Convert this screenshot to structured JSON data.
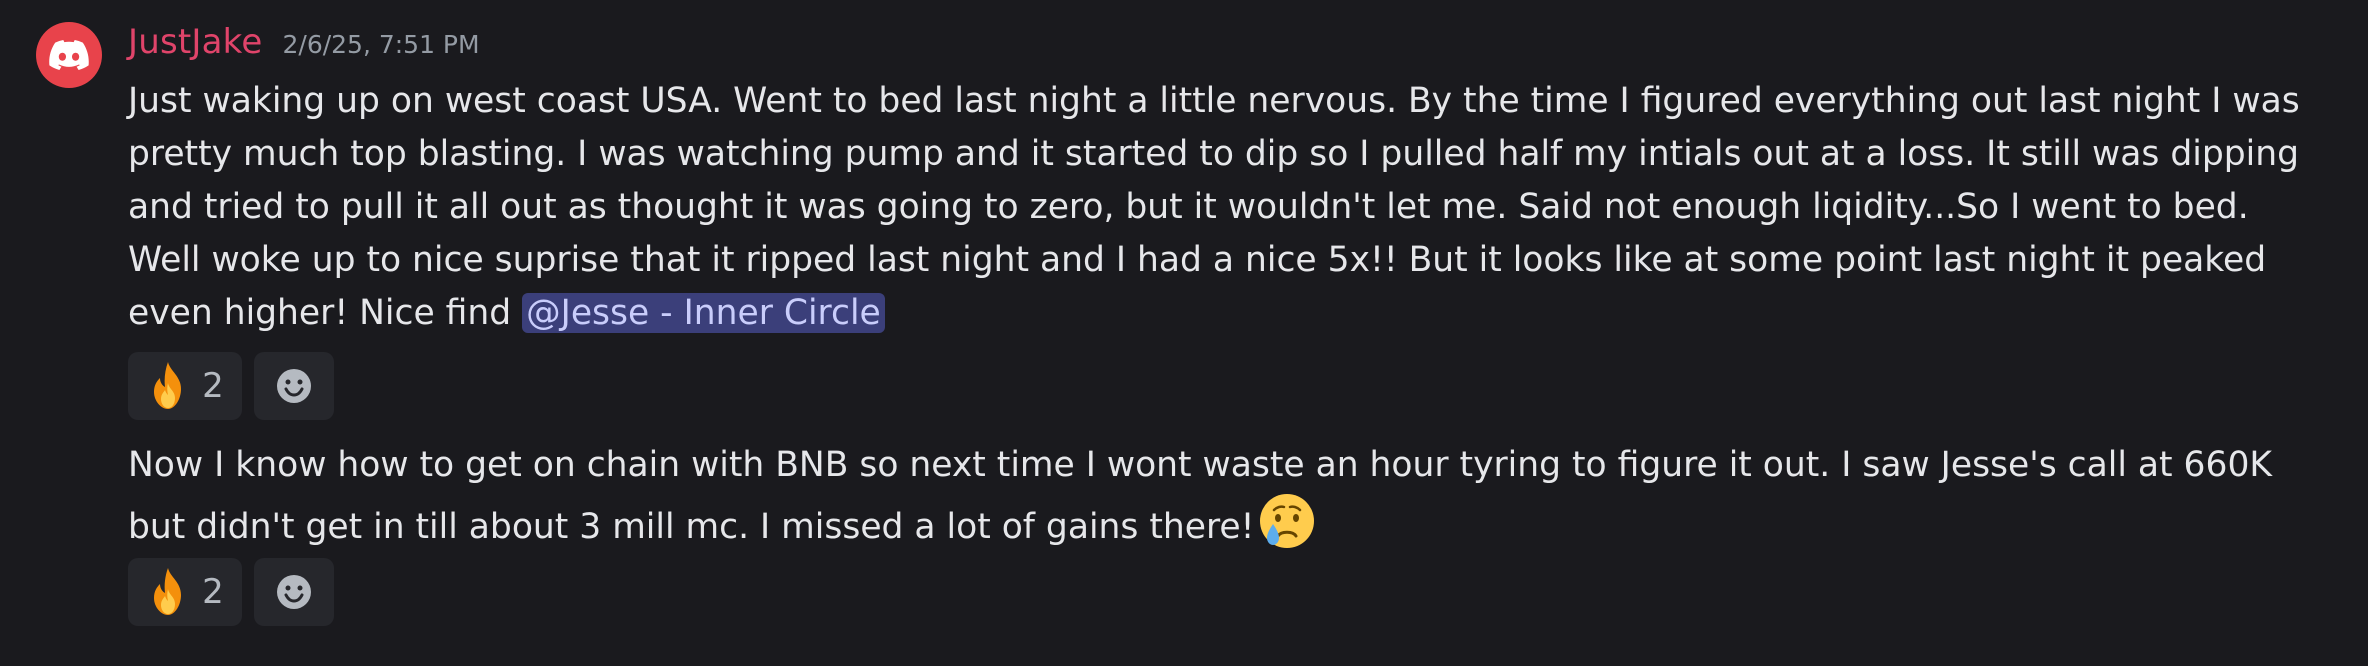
{
  "user": {
    "name": "JustJake",
    "timestamp": "2/6/25, 7:51 PM",
    "avatar_icon": "discord-logo-icon",
    "name_color": "#e0446a",
    "avatar_color": "#e8434b"
  },
  "messages": [
    {
      "text": "Just waking up on west coast USA. Went to bed last night a little nervous. By the time I figured everything out last night I was pretty much top blasting. I was watching pump and it started to dip so I pulled half my intials out at a loss. It still was dipping and tried to pull it all out as thought it was going to zero, but it wouldn't let me. Said not enough liqidity...So I went to bed. Well woke up to nice suprise that it ripped last night and I had a nice 5x!! But it looks like at some point last night it peaked even higher! Nice find ",
      "mention": "@Jesse - Inner Circle",
      "reactions": [
        {
          "emoji": "fire-emoji",
          "count": "2"
        },
        {
          "emoji": "add-reaction-icon",
          "count": ""
        }
      ]
    },
    {
      "text": "Now I know how to get on chain with BNB so next time I wont waste an hour tyring to figure it out. I saw Jesse's call at 660K but didn't get in till about 3 mill mc. I missed a lot of gains there!",
      "trailing_emoji": "crying-face-emoji",
      "reactions": [
        {
          "emoji": "fire-emoji",
          "count": "2"
        },
        {
          "emoji": "add-reaction-icon",
          "count": ""
        }
      ]
    }
  ],
  "colors": {
    "background": "#1a1a1e",
    "mention_bg": "#3b3f7a",
    "mention_text": "#c9cdfb",
    "reaction_bg": "#26272c",
    "timestamp": "#949ba4"
  }
}
